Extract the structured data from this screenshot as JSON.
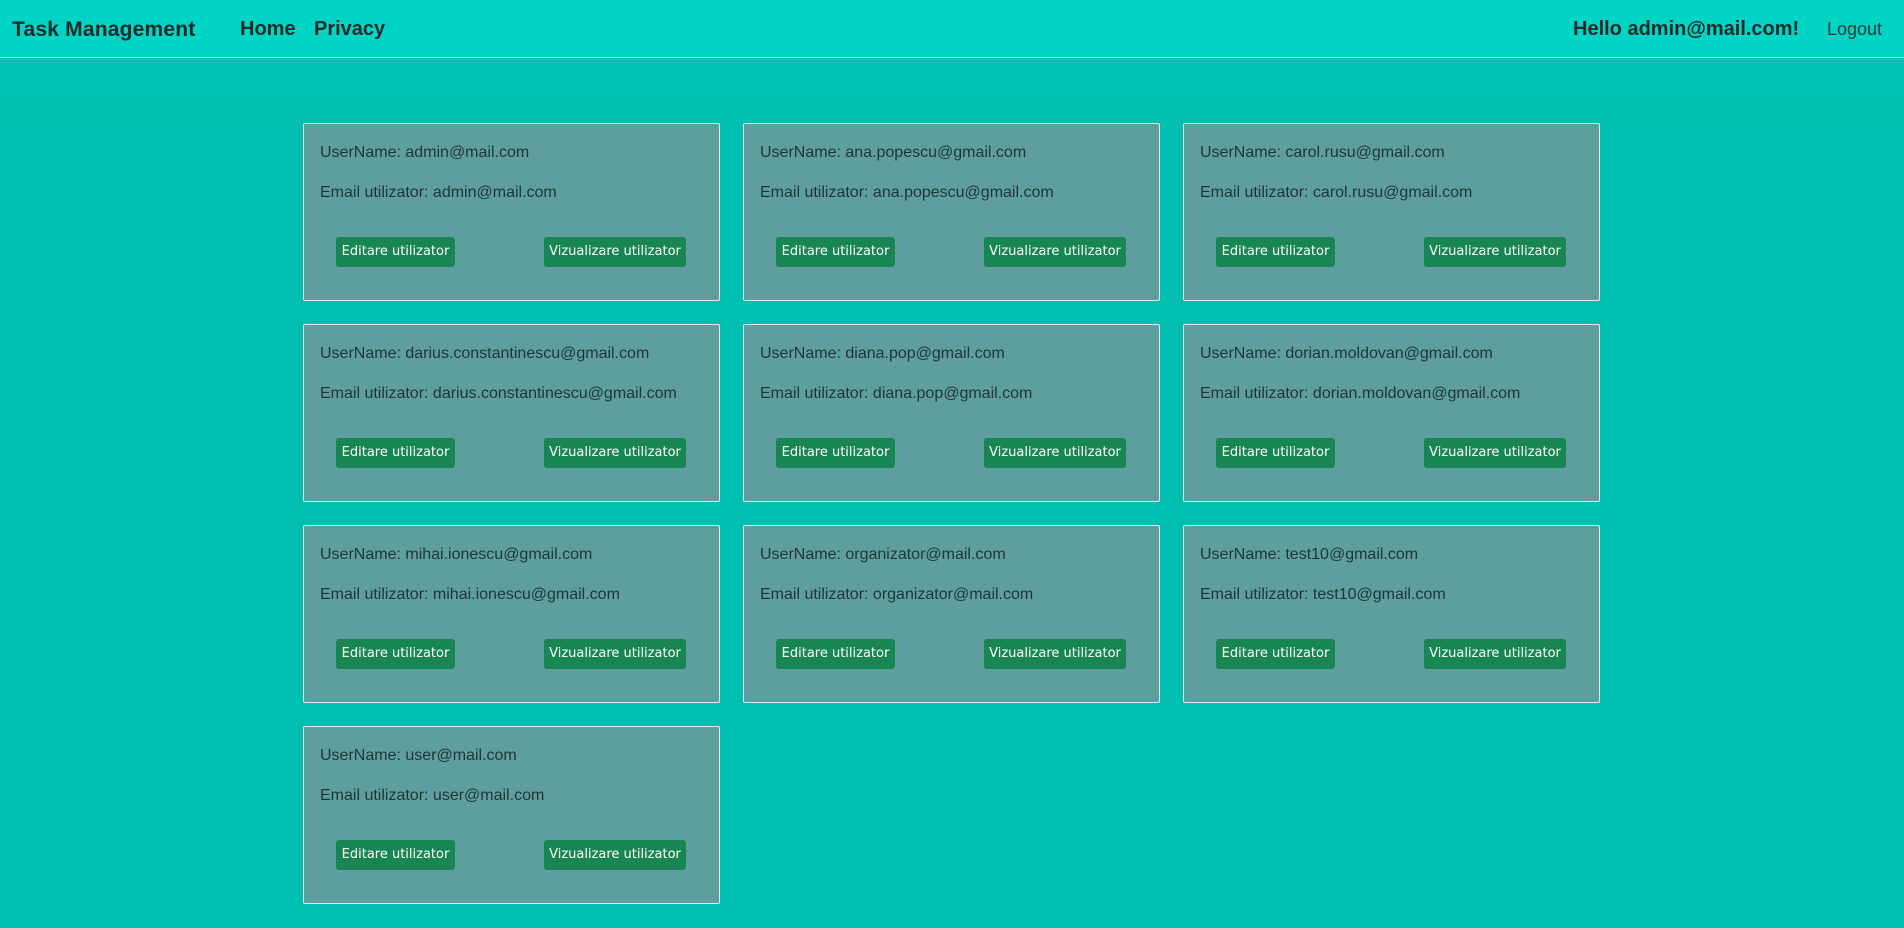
{
  "navbar": {
    "brand": "Task Management",
    "links": [
      "Home",
      "Privacy"
    ],
    "greeting": "Hello admin@mail.com!",
    "logout": "Logout"
  },
  "labels": {
    "username_prefix": "UserName: ",
    "email_prefix": "Email utilizator: ",
    "edit_button": "Editare utilizator",
    "view_button": "Vizualizare utilizator"
  },
  "users": [
    {
      "username": "admin@mail.com",
      "email": "admin@mail.com"
    },
    {
      "username": "ana.popescu@gmail.com",
      "email": "ana.popescu@gmail.com"
    },
    {
      "username": "carol.rusu@gmail.com",
      "email": "carol.rusu@gmail.com"
    },
    {
      "username": "darius.constantinescu@gmail.com",
      "email": "darius.constantinescu@gmail.com"
    },
    {
      "username": "diana.pop@gmail.com",
      "email": "diana.pop@gmail.com"
    },
    {
      "username": "dorian.moldovan@gmail.com",
      "email": "dorian.moldovan@gmail.com"
    },
    {
      "username": "mihai.ionescu@gmail.com",
      "email": "mihai.ionescu@gmail.com"
    },
    {
      "username": "organizator@mail.com",
      "email": "organizator@mail.com"
    },
    {
      "username": "test10@gmail.com",
      "email": "test10@gmail.com"
    },
    {
      "username": "user@mail.com",
      "email": "user@mail.com"
    }
  ],
  "colors": {
    "page_background": "#00bfb1",
    "navbar_background": "#00d4c4",
    "card_background": "#5f9e9e",
    "button_background": "#188653"
  }
}
